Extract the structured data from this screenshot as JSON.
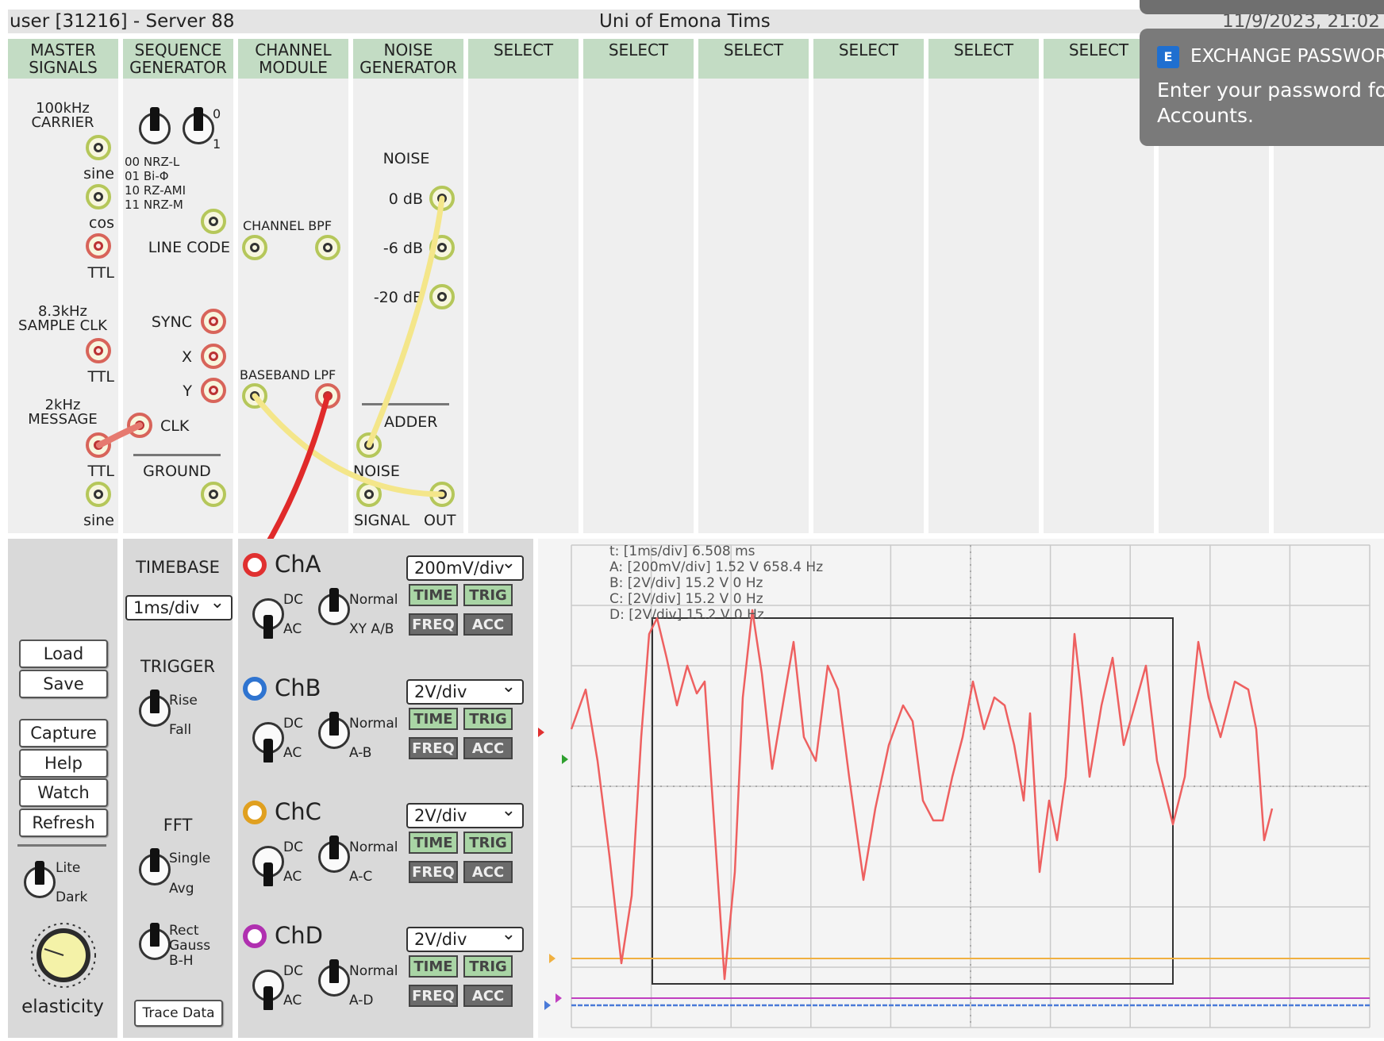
{
  "title_bar": {
    "user": "user [31216] - Server 88",
    "title": "Uni of Emona Tims",
    "datetime": "11/9/2023, 21:02"
  },
  "columns": [
    "MASTER\nSIGNALS",
    "SEQUENCE\nGENERATOR",
    "CHANNEL\nMODULE",
    "NOISE\nGENERATOR",
    "SELECT",
    "SELECT",
    "SELECT",
    "SELECT",
    "SELECT",
    "SELECT"
  ],
  "master": {
    "carrier": "100kHz\nCARRIER",
    "sine": "sine",
    "cos": "cos",
    "ttl1": "TTL",
    "sample_clk": "8.3kHz\nSAMPLE CLK",
    "ttl2": "TTL",
    "message": "2kHz\nMESSAGE",
    "ttl3": "TTL",
    "sine2": "sine"
  },
  "seqgen": {
    "switch_0": "0",
    "switch_1": "1",
    "codes": "00 NRZ-L\n01 Bi-Φ\n10 RZ-AMI\n11 NRZ-M",
    "line_code": "LINE CODE",
    "sync": "SYNC",
    "x": "X",
    "y": "Y",
    "clk": "CLK",
    "ground": "GROUND"
  },
  "channel": {
    "bpf": "CHANNEL BPF",
    "lpf": "BASEBAND LPF"
  },
  "noise": {
    "title": "NOISE",
    "db0": "0 dB",
    "db6": "-6 dB",
    "db20": "-20 dB",
    "adder": "ADDER",
    "noise_in": "NOISE",
    "signal": "SIGNAL",
    "out": "OUT"
  },
  "notification": {
    "title": "EXCHANGE PASSWOR",
    "body": "Enter your password for\nAccounts."
  },
  "controls": {
    "buttons": [
      "Load",
      "Save",
      "Capture",
      "Help",
      "Watch",
      "Refresh"
    ],
    "lite": "Lite",
    "dark": "Dark",
    "elasticity": "elasticity",
    "timebase_label": "TIMEBASE",
    "timebase_value": "1ms/div",
    "trigger_label": "TRIGGER",
    "rise": "Rise",
    "fall": "Fall",
    "fft_label": "FFT",
    "single": "Single",
    "avg": "Avg",
    "window": "Rect\nGauss\nB-H",
    "trace_data": "Trace Data"
  },
  "channels": [
    {
      "name": "ChA",
      "color": "#e03030",
      "vdiv": "200mV/div",
      "mode": "XY A/B"
    },
    {
      "name": "ChB",
      "color": "#2f74d0",
      "vdiv": "2V/div",
      "mode": "A-B"
    },
    {
      "name": "ChC",
      "color": "#e0a020",
      "vdiv": "2V/div",
      "mode": "A-C"
    },
    {
      "name": "ChD",
      "color": "#b030b0",
      "vdiv": "2V/div",
      "mode": "A-D"
    }
  ],
  "channel_labels": {
    "dc": "DC",
    "ac": "AC",
    "normal": "Normal",
    "time": "TIME",
    "trig": "TRIG",
    "freq": "FREQ",
    "acc": "ACC"
  },
  "scope": {
    "readout": [
      "t: [1ms/div] 6.508 ms",
      "A: [200mV/div] 1.52 V  658.4 Hz",
      "B: [2V/div] 15.2 V  0 Hz",
      "C: [2V/div] 15.2 V  0 Hz",
      "D: [2V/div] 15.2 V  0 Hz"
    ]
  }
}
